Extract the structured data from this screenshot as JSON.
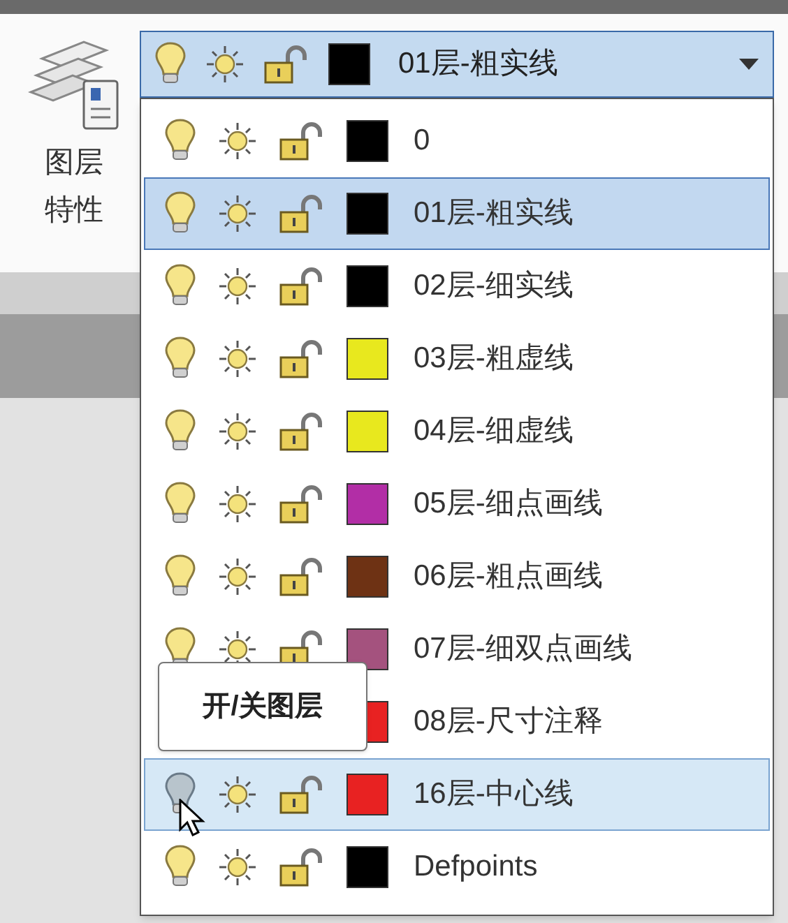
{
  "panel": {
    "label_line_1": "图层",
    "label_line_2": "特性"
  },
  "combo": {
    "value": "01层-粗实线",
    "color": "#000000"
  },
  "layers": [
    {
      "name": "0",
      "color": "#000000",
      "selected": false,
      "hovered": false
    },
    {
      "name": "01层-粗实线",
      "color": "#000000",
      "selected": true,
      "hovered": false
    },
    {
      "name": "02层-细实线",
      "color": "#000000",
      "selected": false,
      "hovered": false
    },
    {
      "name": "03层-粗虚线",
      "color": "#e8e81e",
      "selected": false,
      "hovered": false
    },
    {
      "name": "04层-细虚线",
      "color": "#e8e81e",
      "selected": false,
      "hovered": false
    },
    {
      "name": "05层-细点画线",
      "color": "#b22ea6",
      "selected": false,
      "hovered": false
    },
    {
      "name": "06层-粗点画线",
      "color": "#6e3214",
      "selected": false,
      "hovered": false
    },
    {
      "name": "07层-细双点画线",
      "color": "#a4527e",
      "selected": false,
      "hovered": false
    },
    {
      "name": "08层-尺寸注释",
      "color": "#e82222",
      "selected": false,
      "hovered": false
    },
    {
      "name": "16层-中心线",
      "color": "#e82222",
      "selected": false,
      "hovered": true
    },
    {
      "name": "Defpoints",
      "color": "#000000",
      "selected": false,
      "hovered": false
    }
  ],
  "tooltip": {
    "text": "开/关图层"
  }
}
